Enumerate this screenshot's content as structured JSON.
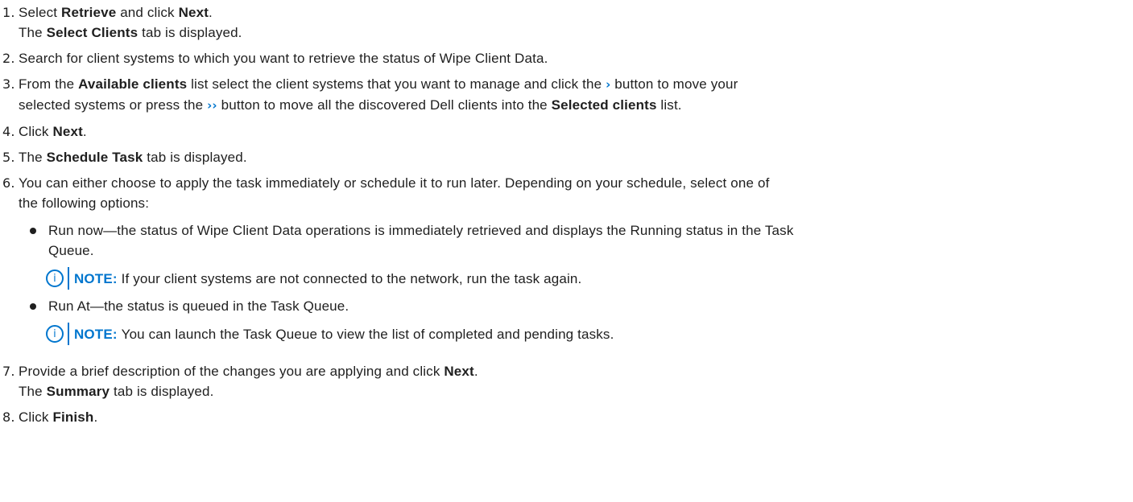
{
  "colors": {
    "accent": "#0076ce",
    "text": "#1f1f1f"
  },
  "icons": {
    "chevron_single": "›",
    "chevron_double": "››",
    "note_icon": "i"
  },
  "steps": [
    {
      "num": "1.",
      "a": "Select ",
      "b": "Retrieve",
      "c": " and click ",
      "d": "Next",
      "e": ".",
      "l2a": "The ",
      "l2b": "Select Clients",
      "l2c": " tab is displayed."
    },
    {
      "num": "2.",
      "text": "Search for client systems to which you want to retrieve the status of Wipe Client Data."
    },
    {
      "num": "3.",
      "a": "From the ",
      "b": "Available clients",
      "c": " list select the client systems that you want to manage and click the ",
      "d": " button to move your",
      "l2a": "selected systems or press the ",
      "l2b": " button to move all the discovered Dell clients into the ",
      "l2c": "Selected clients",
      "l2d": " list."
    },
    {
      "num": "4.",
      "a": "Click ",
      "b": "Next",
      "c": "."
    },
    {
      "num": "5.",
      "a": "The ",
      "b": "Schedule Task",
      "c": " tab is displayed."
    },
    {
      "num": "6.",
      "l1": "You can either choose to apply the task immediately or schedule it to run later. Depending on your schedule, select one of",
      "l2": "the following options:",
      "options": [
        {
          "l1": "Run now—the status of Wipe Client Data operations is immediately retrieved and displays the Running status in the Task",
          "l2": "Queue.",
          "note_label": "NOTE:",
          "note_text": "If your client systems are not connected to the network, run the task again."
        },
        {
          "l1": "Run At—the status is queued in the Task Queue.",
          "note_label": "NOTE:",
          "note_text": "You can launch the Task Queue to view the list of completed and pending tasks."
        }
      ]
    },
    {
      "num": "7.",
      "a": "Provide a brief description of the changes you are applying and click ",
      "b": "Next",
      "c": ".",
      "l2a": "The ",
      "l2b": "Summary",
      "l2c": " tab is displayed."
    },
    {
      "num": "8.",
      "a": "Click ",
      "b": "Finish",
      "c": "."
    }
  ]
}
